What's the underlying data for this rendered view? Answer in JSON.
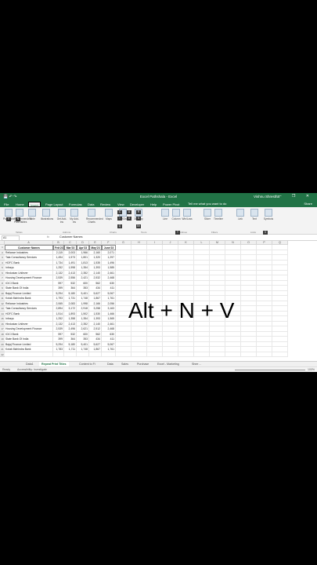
{
  "window": {
    "title": "Excel Pathshala - Excel",
    "user": "Vishnu Shrestha",
    "qat": "💾 ↶ ↷",
    "controls": "— ❐ ✕"
  },
  "tabs": [
    "File",
    "Home",
    "Insert",
    "Page Layout",
    "Formulas",
    "Data",
    "Review",
    "View",
    "Developer",
    "Help",
    "Power Pivot"
  ],
  "active_tab": "Insert",
  "tell_me": "Tell me what you want to do",
  "share": "Share",
  "ribbon": {
    "buttons": [
      "PivotTable",
      "Recommended PivotTables",
      "Table",
      "Illustrations",
      "Get Add-ins",
      "My Add-ins",
      "Recommended Charts",
      "Maps",
      "PivotChart",
      "3D Map",
      "Line",
      "Column",
      "Win/Loss",
      "Slicer",
      "Timeline",
      "Link",
      "Text",
      "Symbols"
    ],
    "groups": [
      "Tables",
      "Add-ins",
      "Charts",
      "Tours",
      "Sparklines",
      "Filters",
      "Links"
    ],
    "keytips": [
      "V",
      "N",
      "C",
      "A",
      "R",
      "I",
      "O",
      "S",
      "Q",
      "SV",
      "T",
      "X"
    ]
  },
  "name_box": "A1",
  "formula": "Customer Names",
  "columns": [
    "A",
    "B",
    "C",
    "D",
    "E",
    "F",
    "G",
    "H",
    "I",
    "J",
    "K",
    "L",
    "M",
    "N",
    "O",
    "P",
    "Q"
  ],
  "headers": [
    "Customer Names",
    "Feb'23",
    "Mar'23",
    "Apr'23",
    "May'23",
    "June'23"
  ],
  "rows": [
    [
      "Reliance Industries",
      "2,115",
      "2,003",
      "1,966",
      "2,160",
      "2,071"
    ],
    [
      "Tata Consultancy Services",
      "1,494",
      "1,573",
      "1,801",
      "1,320",
      "1,297"
    ],
    [
      "HDFC Bank",
      "1,734",
      "1,491",
      "1,813",
      "1,535",
      "1,496"
    ],
    [
      "Infosys",
      "1,252",
      "1,598",
      "1,354",
      "1,393",
      "1,585"
    ],
    [
      "Hindustan Unilever",
      "2,132",
      "2,413",
      "2,352",
      "2,140",
      "2,461"
    ],
    [
      "Housing Development Finance",
      "2,539",
      "2,556",
      "2,421",
      "2,532",
      "2,468"
    ],
    [
      "ICICI Bank",
      "597",
      "532",
      "600",
      "562",
      "630"
    ],
    [
      "State Bank Of India",
      "399",
      "364",
      "353",
      "434",
      "411"
    ],
    [
      "Bajaj Finance Limited",
      "5,294",
      "5,180",
      "5,401",
      "5,627",
      "5,067"
    ],
    [
      "Kotak Mahindra Bank",
      "1,793",
      "1,731",
      "1,748",
      "1,867",
      "1,761"
    ],
    [
      "Reliance Industries",
      "2,065",
      "2,083",
      "1,998",
      "2,166",
      "2,056"
    ],
    [
      "Tata Consultancy Services",
      "2,894",
      "3,172",
      "2,918",
      "3,258",
      "3,163"
    ],
    [
      "HDFC Bank",
      "1,514",
      "1,893",
      "1,502",
      "1,530",
      "1,466"
    ],
    [
      "Infosys",
      "1,252",
      "1,358",
      "1,354",
      "1,393",
      "1,565"
    ],
    [
      "Hindustan Unilever",
      "2,132",
      "2,413",
      "2,352",
      "2,140",
      "2,461"
    ],
    [
      "Housing Development Finance",
      "2,539",
      "2,496",
      "2,621",
      "2,512",
      "2,468"
    ],
    [
      "ICICI Bank",
      "597",
      "532",
      "600",
      "562",
      "630"
    ],
    [
      "State Bank Of India",
      "399",
      "364",
      "353",
      "434",
      "411"
    ],
    [
      "Bajaj Finance Limited",
      "5,294",
      "5,180",
      "5,401",
      "5,627",
      "5,067"
    ],
    [
      "Kotak Mahindra Bank",
      "1,783",
      "1,711",
      "1,748",
      "1,867",
      "1,761"
    ]
  ],
  "sheet_tabs": [
    "Data1",
    "Repeat Print Titles",
    "Content to Fi",
    "Data",
    "Sales",
    "Purchase",
    "Excel - Marketing",
    "Shee ..."
  ],
  "active_sheet": "Repeat Print Titles",
  "status": {
    "ready": "Ready",
    "accessibility": "Accessibility: Investigate",
    "zoom": "100%"
  },
  "shortcut": "Alt + N + V"
}
